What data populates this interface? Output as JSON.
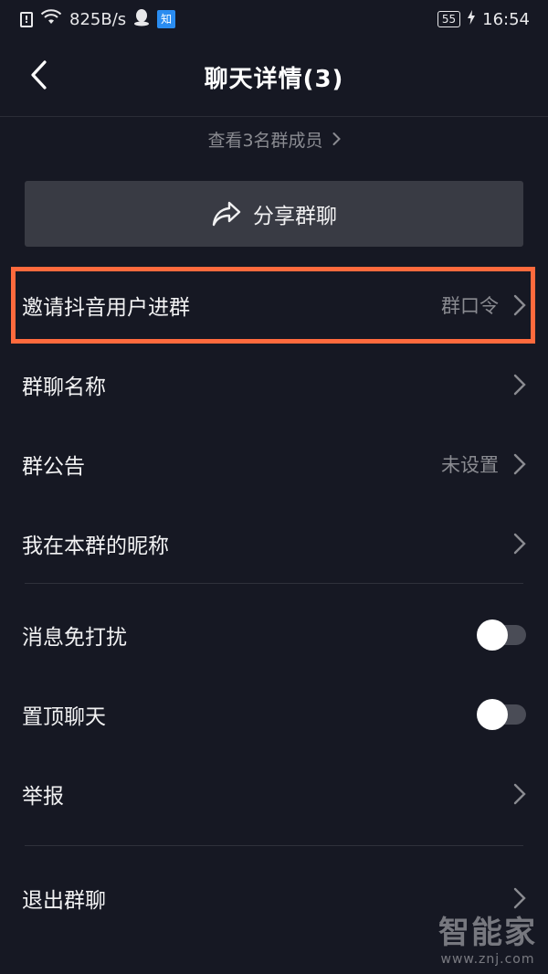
{
  "status_bar": {
    "network_speed": "825B/s",
    "app_icon_label": "知",
    "battery": "55",
    "time": "16:54",
    "icons": [
      "alert-icon",
      "wifi-icon",
      "qq-icon",
      "zhihu-icon",
      "battery-icon",
      "charging-icon"
    ]
  },
  "header": {
    "title": "聊天详情(3)",
    "back_icon": "chevron-left-icon"
  },
  "members_link": {
    "label": "查看3名群成员"
  },
  "share_button": {
    "label": "分享群聊",
    "icon": "share-icon"
  },
  "rows": [
    {
      "label": "邀请抖音用户进群",
      "value": "群口令",
      "control": "chevron",
      "highlighted": true
    },
    {
      "label": "群聊名称",
      "value": "",
      "control": "chevron"
    },
    {
      "label": "群公告",
      "value": "未设置",
      "control": "chevron"
    },
    {
      "label": "我在本群的昵称",
      "value": "",
      "control": "chevron"
    },
    {
      "label": "消息免打扰",
      "control": "toggle",
      "toggle_on": false
    },
    {
      "label": "置顶聊天",
      "control": "toggle",
      "toggle_on": false
    },
    {
      "label": "举报",
      "value": "",
      "control": "chevron"
    },
    {
      "label": "退出群聊",
      "value": "",
      "control": "chevron"
    }
  ],
  "watermark": {
    "main": "智能家",
    "sub": "www.znj.com"
  },
  "colors": {
    "background": "#161823",
    "share_button_bg": "#393b44",
    "highlight": "#ff6a3d",
    "secondary_text": "#8a8b91"
  }
}
